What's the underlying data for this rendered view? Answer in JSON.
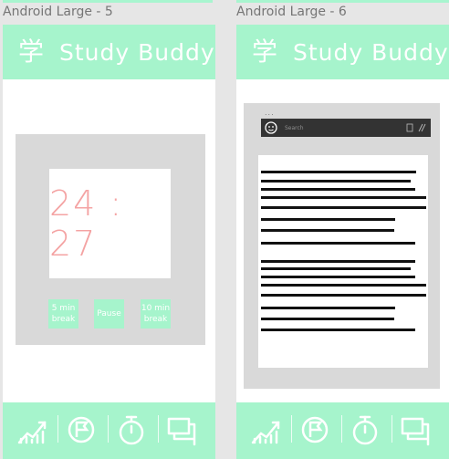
{
  "frames": [
    {
      "label": "Android Large - 5"
    },
    {
      "label": "Android Large - 6"
    }
  ],
  "app": {
    "title": "Study Buddy",
    "logo_glyph": "学",
    "brand_color": "#a6f4cc",
    "accent_color": "#f4a3a3"
  },
  "timer": {
    "display": "24 : 27",
    "buttons": {
      "break5": "5 min break",
      "pause": "Pause",
      "break10": "10 min break"
    }
  },
  "reader": {
    "dots": "...",
    "search_placeholder": "Search",
    "avatar_icon": "face-icon",
    "action_icons": [
      "edit-icon",
      "attach-icon"
    ]
  },
  "nav": {
    "items": [
      {
        "icon": "stats-icon"
      },
      {
        "icon": "flag-icon"
      },
      {
        "icon": "stopwatch-icon"
      },
      {
        "icon": "chat-icon"
      }
    ]
  }
}
